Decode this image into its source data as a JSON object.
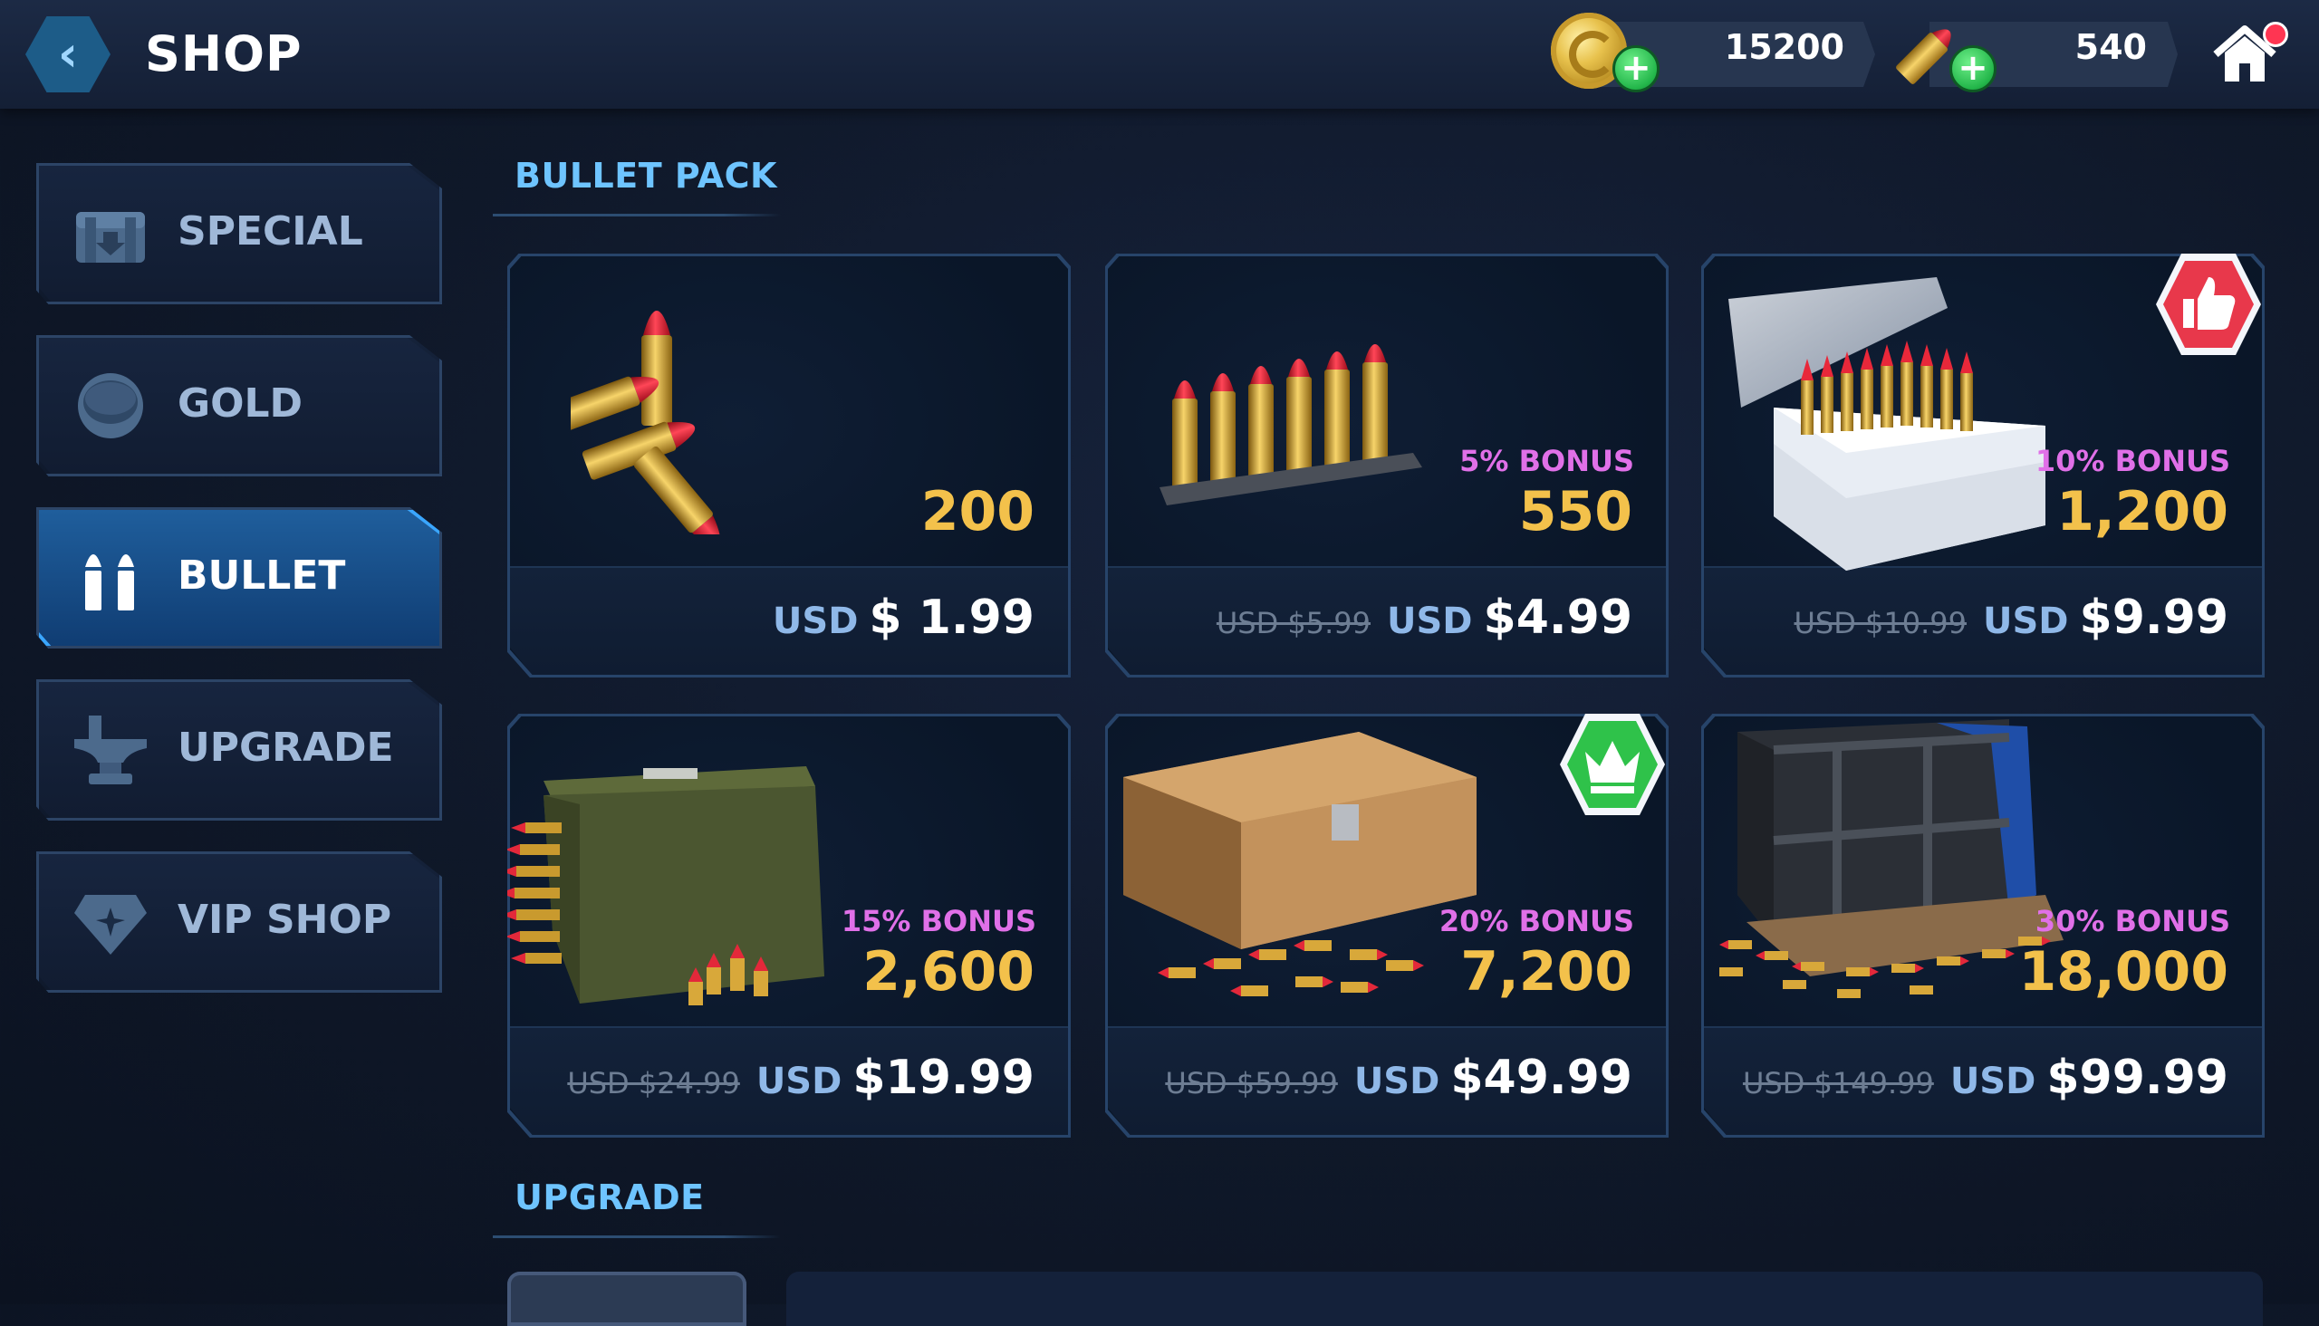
{
  "header": {
    "back_icon": "chevron-left-icon",
    "title": "SHOP",
    "gold": "15200",
    "bullets": "540",
    "home_icon": "home-icon"
  },
  "sidebar": {
    "items": [
      {
        "label": "SPECIAL",
        "icon": "chest-icon",
        "active": false
      },
      {
        "label": "GOLD",
        "icon": "gold-coin-icon",
        "active": false
      },
      {
        "label": "BULLET",
        "icon": "bullets-icon",
        "active": true
      },
      {
        "label": "UPGRADE",
        "icon": "anvil-icon",
        "active": false
      },
      {
        "label": "VIP SHOP",
        "icon": "diamond-icon",
        "active": false
      }
    ]
  },
  "sections": {
    "bullet_pack": "BULLET PACK",
    "upgrade": "UPGRADE"
  },
  "packs": [
    {
      "amount": "200",
      "bonus": "",
      "old_price": "",
      "currency": "USD",
      "price": "$ 1.99",
      "art": "three-bullets",
      "badge": ""
    },
    {
      "amount": "550",
      "bonus": "5% BONUS",
      "old_price": "USD $5.99",
      "currency": "USD",
      "price": "$4.99",
      "art": "bullet-clip",
      "badge": ""
    },
    {
      "amount": "1,200",
      "bonus": "10% BONUS",
      "old_price": "USD $10.99",
      "currency": "USD",
      "price": "$9.99",
      "art": "ammo-tray-box",
      "badge": "thumbs-up-badge-icon"
    },
    {
      "amount": "2,600",
      "bonus": "15% BONUS",
      "old_price": "USD $24.99",
      "currency": "USD",
      "price": "$19.99",
      "art": "ammo-can",
      "badge": ""
    },
    {
      "amount": "7,200",
      "bonus": "20% BONUS",
      "old_price": "USD $59.99",
      "currency": "USD",
      "price": "$49.99",
      "art": "wooden-crate",
      "badge": "crown-badge-icon"
    },
    {
      "amount": "18,000",
      "bonus": "30% BONUS",
      "old_price": "USD $149.99",
      "currency": "USD",
      "price": "$99.99",
      "art": "supply-crate",
      "badge": ""
    }
  ],
  "colors": {
    "accent_blue": "#3aa6ff",
    "amount_gold": "#f3c14b",
    "bonus_purple": "#e070e8",
    "plus_green": "#23b64a"
  }
}
